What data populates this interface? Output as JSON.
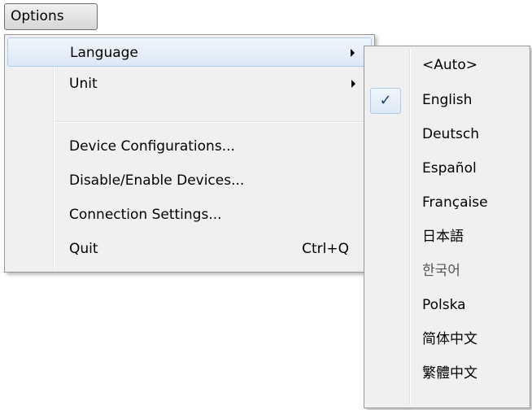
{
  "menubar": {
    "options_label": "Options"
  },
  "menu": {
    "items": [
      {
        "label": "Language",
        "has_submenu": true
      },
      {
        "label": "Unit",
        "has_submenu": true
      },
      {
        "label": "Device Configurations..."
      },
      {
        "label": "Disable/Enable Devices..."
      },
      {
        "label": "Connection Settings..."
      },
      {
        "label": "Quit",
        "shortcut": "Ctrl+Q"
      }
    ]
  },
  "language_submenu": {
    "checked": "English",
    "check_mark": "✓",
    "items": [
      {
        "label": "<Auto>"
      },
      {
        "label": "English"
      },
      {
        "label": "Deutsch"
      },
      {
        "label": "Español"
      },
      {
        "label": "Française"
      },
      {
        "label": "日本語"
      },
      {
        "label": "한국어"
      },
      {
        "label": "Polska"
      },
      {
        "label": "简体中文"
      },
      {
        "label": "繁體中文"
      }
    ]
  }
}
